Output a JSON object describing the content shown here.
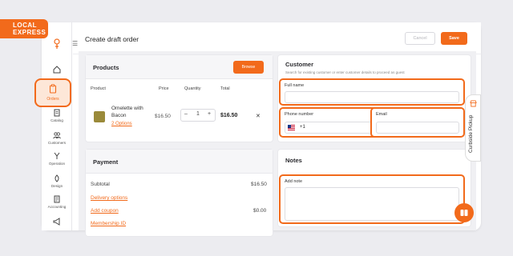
{
  "brand": {
    "logo_line1": "LOCAL",
    "logo_line2": "EXPRESS",
    "accent": "#f26a1b"
  },
  "sidebar": {
    "items": [
      {
        "label": "",
        "icon": "home-icon"
      },
      {
        "label": "Orders",
        "icon": "clipboard-icon",
        "active": true
      },
      {
        "label": "Catalog",
        "icon": "catalog-icon"
      },
      {
        "label": "Customers",
        "icon": "customers-icon"
      },
      {
        "label": "Operation",
        "icon": "operation-icon"
      },
      {
        "label": "Design",
        "icon": "design-icon"
      },
      {
        "label": "Accounting",
        "icon": "accounting-icon"
      },
      {
        "label": "",
        "icon": "megaphone-icon"
      }
    ]
  },
  "header": {
    "title": "Create draft order",
    "cancel_label": "Cancel",
    "save_label": "Save"
  },
  "products": {
    "title": "Products",
    "browse_label": "Browse",
    "columns": [
      "Product",
      "Price",
      "Quantity",
      "Total"
    ],
    "rows": [
      {
        "name": "Omelette with Bacon",
        "variants_label": "2 Options",
        "price": "$16.50",
        "quantity": "1",
        "total": "$16.50"
      }
    ]
  },
  "payment": {
    "title": "Payment",
    "subtotal_label": "Subtotal",
    "subtotal_value": "$16.50",
    "delivery_label": "Delivery options",
    "coupon_label": "Add coupon",
    "coupon_value": "$0.00",
    "membership_label": "Membership ID"
  },
  "customer": {
    "title": "Customer",
    "subtitle": "Search for existing customer or enter customer details to proceed as guest",
    "full_name_label": "Full name",
    "phone_label": "Phone number",
    "phone_code": "+1",
    "email_label": "Email"
  },
  "notes": {
    "title": "Notes",
    "add_note_label": "Add note"
  },
  "curbside": {
    "label": "Curbside Pickup"
  }
}
